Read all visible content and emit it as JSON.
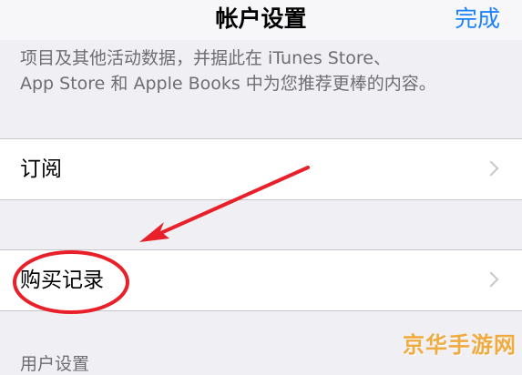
{
  "nav": {
    "title": "帐户设置",
    "done_label": "完成"
  },
  "footer_note": {
    "line1": "项目及其他活动数据，并据此在 iTunes Store、",
    "line2": "App Store 和 Apple Books 中为您推荐更棒的内容。"
  },
  "rows": {
    "subscriptions": "订阅",
    "purchase_history": "购买记录"
  },
  "bottom_partial": "用户设置",
  "watermark": "京华手游网",
  "colors": {
    "accent": "#1a82fb",
    "annotation_red": "#e8202a",
    "background": "#efeff4"
  }
}
